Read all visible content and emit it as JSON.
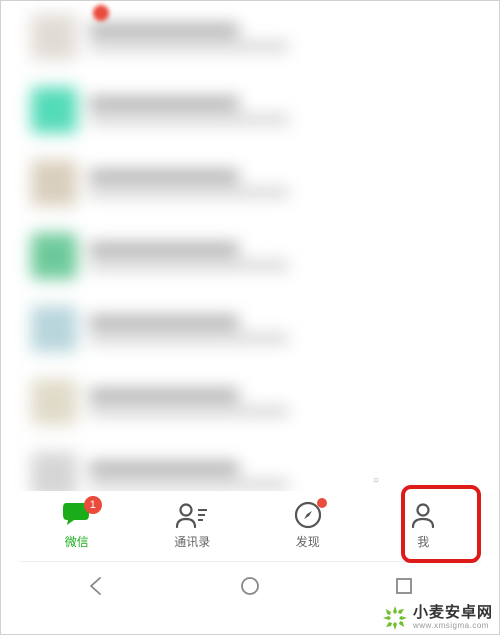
{
  "colors": {
    "accent": "#1AAD19",
    "badge": "#e94b3c",
    "highlight": "#dd1c1a"
  },
  "chats": [
    {
      "avatar_bg": "#d8d0c8"
    },
    {
      "avatar_bg": "#1bcfa1"
    },
    {
      "avatar_bg": "#cdbfa8"
    },
    {
      "avatar_bg": "#3cb878"
    },
    {
      "avatar_bg": "#a0c8d0"
    },
    {
      "avatar_bg": "#d6cfb8"
    }
  ],
  "tabs": [
    {
      "key": "chats",
      "label": "微信",
      "badge": "1",
      "active": true
    },
    {
      "key": "contacts",
      "label": "通讯录"
    },
    {
      "key": "discover",
      "label": "发现",
      "has_dot": true
    },
    {
      "key": "me",
      "label": "我",
      "highlighted": true
    }
  ],
  "watermark": {
    "title": "小麦安卓网",
    "url": "www.xmsigma.com"
  }
}
